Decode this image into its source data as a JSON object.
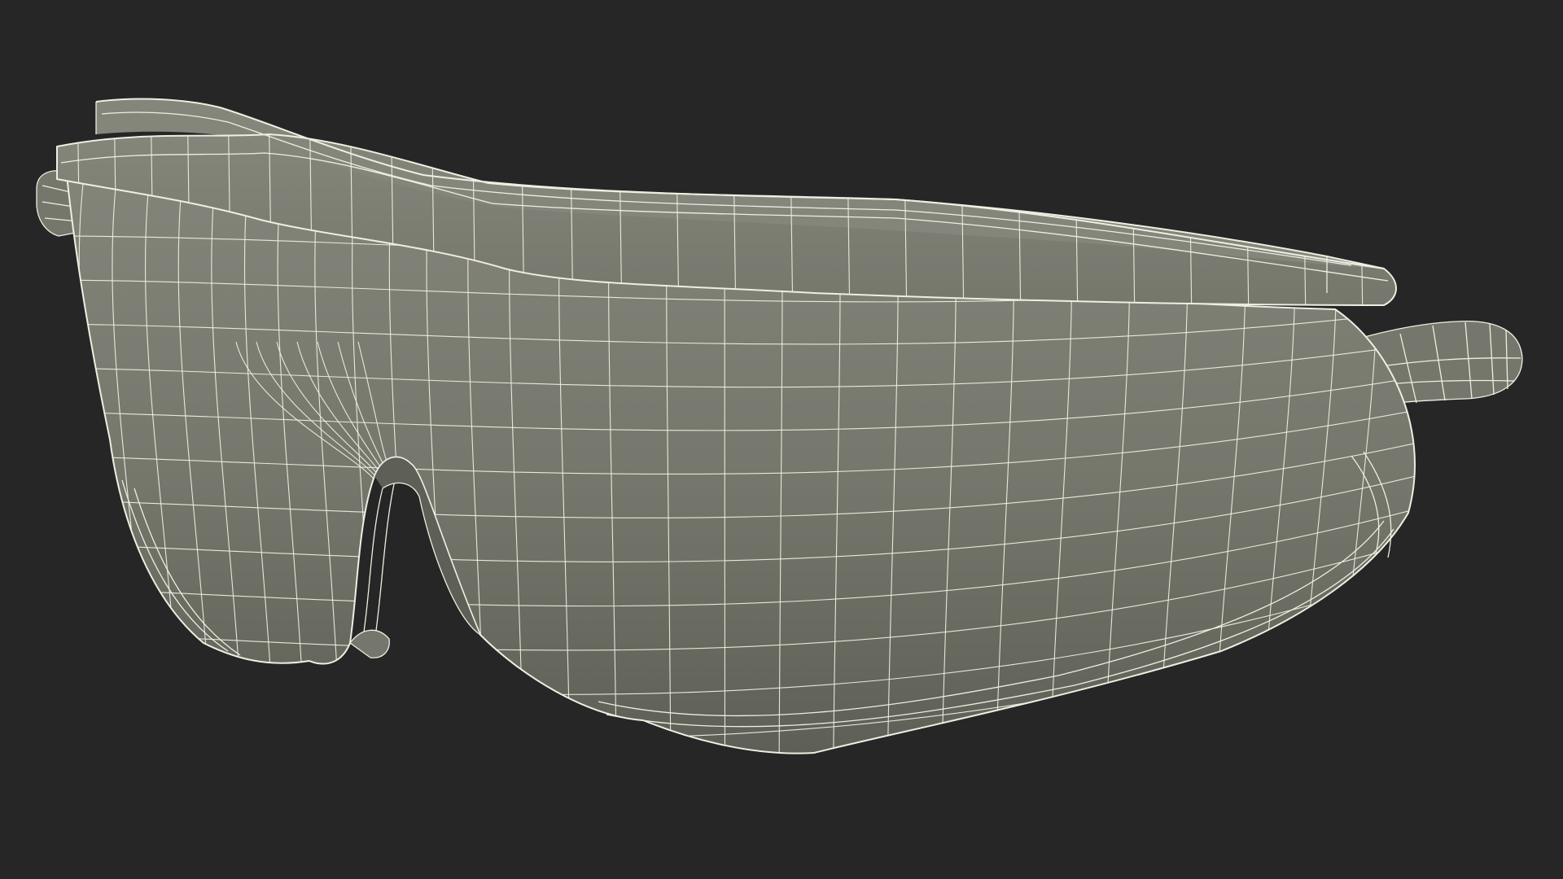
{
  "scene": {
    "subject": "wireframe-safety-glasses-icon",
    "colors": {
      "background": "#262626",
      "surface": "#76776c",
      "surface_light": "#85867b",
      "surface_dark": "#5e5f56",
      "wire": "#eeeee2"
    }
  }
}
